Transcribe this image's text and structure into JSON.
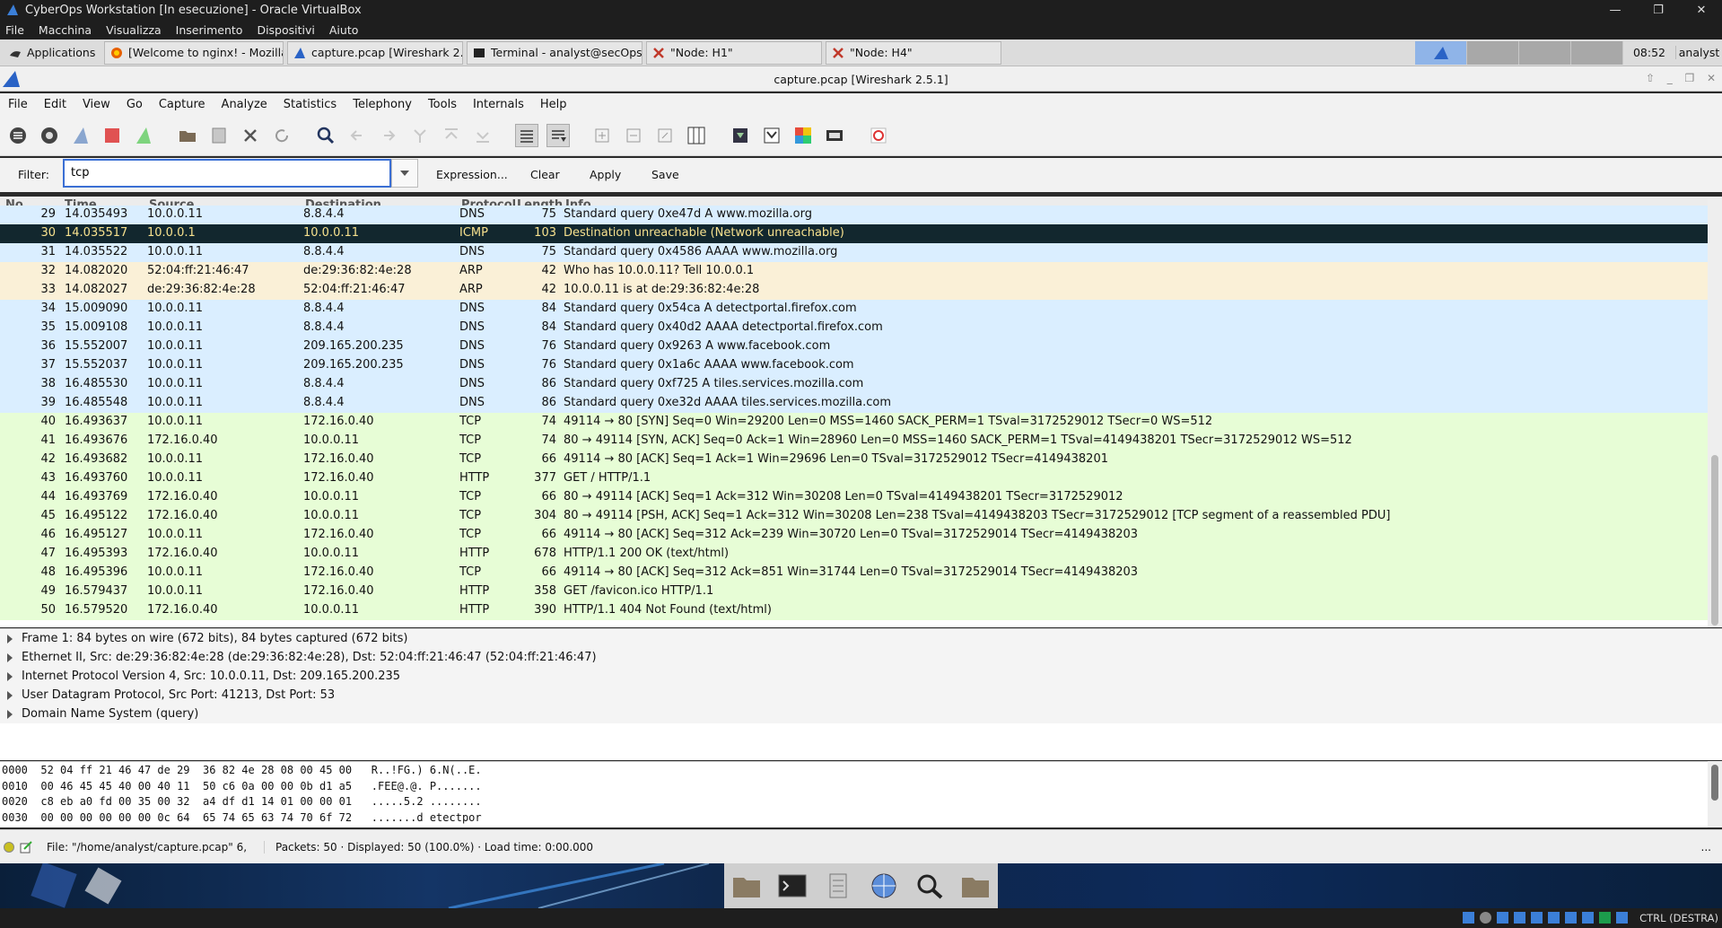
{
  "vbox": {
    "title": "CyberOps Workstation [In esecuzione] - Oracle VirtualBox",
    "menu": [
      "File",
      "Macchina",
      "Visualizza",
      "Inserimento",
      "Dispositivi",
      "Aiuto"
    ],
    "host_key": "CTRL (DESTRA)"
  },
  "taskbar": {
    "applications": "Applications",
    "tasks": [
      "[Welcome to nginx! - Mozilla...",
      "capture.pcap [Wireshark 2....",
      "Terminal - analyst@secOps:~",
      "\"Node: H1\"",
      "\"Node: H4\""
    ],
    "clock": "08:52",
    "user": "analyst"
  },
  "wireshark": {
    "window_title": "capture.pcap [Wireshark 2.5.1]",
    "menu": [
      "File",
      "Edit",
      "View",
      "Go",
      "Capture",
      "Analyze",
      "Statistics",
      "Telephony",
      "Tools",
      "Internals",
      "Help"
    ],
    "filter": {
      "label": "Filter:",
      "value": "tcp",
      "expression": "Expression...",
      "clear": "Clear",
      "apply": "Apply",
      "save": "Save"
    },
    "columns": [
      "No.",
      "Time",
      "Source",
      "Destination",
      "Protocol",
      "Length",
      "Info"
    ],
    "packets": [
      {
        "no": "29",
        "time": "14.035493",
        "src": "10.0.0.11",
        "dst": "8.8.4.4",
        "proto": "DNS",
        "len": "75",
        "info": "Standard query 0xe47d A www.mozilla.org",
        "kind": "udp"
      },
      {
        "no": "30",
        "time": "14.035517",
        "src": "10.0.0.1",
        "dst": "10.0.0.11",
        "proto": "ICMP",
        "len": "103",
        "info": "Destination unreachable (Network unreachable)",
        "kind": "err"
      },
      {
        "no": "31",
        "time": "14.035522",
        "src": "10.0.0.11",
        "dst": "8.8.4.4",
        "proto": "DNS",
        "len": "75",
        "info": "Standard query 0x4586 AAAA www.mozilla.org",
        "kind": "udp"
      },
      {
        "no": "32",
        "time": "14.082020",
        "src": "52:04:ff:21:46:47",
        "dst": "de:29:36:82:4e:28",
        "proto": "ARP",
        "len": "42",
        "info": "Who has 10.0.0.11? Tell 10.0.0.1",
        "kind": "arp"
      },
      {
        "no": "33",
        "time": "14.082027",
        "src": "de:29:36:82:4e:28",
        "dst": "52:04:ff:21:46:47",
        "proto": "ARP",
        "len": "42",
        "info": "10.0.0.11 is at de:29:36:82:4e:28",
        "kind": "arp"
      },
      {
        "no": "34",
        "time": "15.009090",
        "src": "10.0.0.11",
        "dst": "8.8.4.4",
        "proto": "DNS",
        "len": "84",
        "info": "Standard query 0x54ca A detectportal.firefox.com",
        "kind": "udp"
      },
      {
        "no": "35",
        "time": "15.009108",
        "src": "10.0.0.11",
        "dst": "8.8.4.4",
        "proto": "DNS",
        "len": "84",
        "info": "Standard query 0x40d2 AAAA detectportal.firefox.com",
        "kind": "udp"
      },
      {
        "no": "36",
        "time": "15.552007",
        "src": "10.0.0.11",
        "dst": "209.165.200.235",
        "proto": "DNS",
        "len": "76",
        "info": "Standard query 0x9263 A www.facebook.com",
        "kind": "udp"
      },
      {
        "no": "37",
        "time": "15.552037",
        "src": "10.0.0.11",
        "dst": "209.165.200.235",
        "proto": "DNS",
        "len": "76",
        "info": "Standard query 0x1a6c AAAA www.facebook.com",
        "kind": "udp"
      },
      {
        "no": "38",
        "time": "16.485530",
        "src": "10.0.0.11",
        "dst": "8.8.4.4",
        "proto": "DNS",
        "len": "86",
        "info": "Standard query 0xf725 A tiles.services.mozilla.com",
        "kind": "udp"
      },
      {
        "no": "39",
        "time": "16.485548",
        "src": "10.0.0.11",
        "dst": "8.8.4.4",
        "proto": "DNS",
        "len": "86",
        "info": "Standard query 0xe32d AAAA tiles.services.mozilla.com",
        "kind": "udp"
      },
      {
        "no": "40",
        "time": "16.493637",
        "src": "10.0.0.11",
        "dst": "172.16.0.40",
        "proto": "TCP",
        "len": "74",
        "info": "49114 → 80 [SYN] Seq=0 Win=29200 Len=0 MSS=1460 SACK_PERM=1 TSval=3172529012 TSecr=0 WS=512",
        "kind": "tcp"
      },
      {
        "no": "41",
        "time": "16.493676",
        "src": "172.16.0.40",
        "dst": "10.0.0.11",
        "proto": "TCP",
        "len": "74",
        "info": "80 → 49114 [SYN, ACK] Seq=0 Ack=1 Win=28960 Len=0 MSS=1460 SACK_PERM=1 TSval=4149438201 TSecr=3172529012 WS=512",
        "kind": "tcp"
      },
      {
        "no": "42",
        "time": "16.493682",
        "src": "10.0.0.11",
        "dst": "172.16.0.40",
        "proto": "TCP",
        "len": "66",
        "info": "49114 → 80 [ACK] Seq=1 Ack=1 Win=29696 Len=0 TSval=3172529012 TSecr=4149438201",
        "kind": "tcp"
      },
      {
        "no": "43",
        "time": "16.493760",
        "src": "10.0.0.11",
        "dst": "172.16.0.40",
        "proto": "HTTP",
        "len": "377",
        "info": "GET / HTTP/1.1",
        "kind": "tcp"
      },
      {
        "no": "44",
        "time": "16.493769",
        "src": "172.16.0.40",
        "dst": "10.0.0.11",
        "proto": "TCP",
        "len": "66",
        "info": "80 → 49114 [ACK] Seq=1 Ack=312 Win=30208 Len=0 TSval=4149438201 TSecr=3172529012",
        "kind": "tcp"
      },
      {
        "no": "45",
        "time": "16.495122",
        "src": "172.16.0.40",
        "dst": "10.0.0.11",
        "proto": "TCP",
        "len": "304",
        "info": "80 → 49114 [PSH, ACK] Seq=1 Ack=312 Win=30208 Len=238 TSval=4149438203 TSecr=3172529012 [TCP segment of a reassembled PDU]",
        "kind": "tcp"
      },
      {
        "no": "46",
        "time": "16.495127",
        "src": "10.0.0.11",
        "dst": "172.16.0.40",
        "proto": "TCP",
        "len": "66",
        "info": "49114 → 80 [ACK] Seq=312 Ack=239 Win=30720 Len=0 TSval=3172529014 TSecr=4149438203",
        "kind": "tcp"
      },
      {
        "no": "47",
        "time": "16.495393",
        "src": "172.16.0.40",
        "dst": "10.0.0.11",
        "proto": "HTTP",
        "len": "678",
        "info": "HTTP/1.1 200 OK  (text/html)",
        "kind": "tcp"
      },
      {
        "no": "48",
        "time": "16.495396",
        "src": "10.0.0.11",
        "dst": "172.16.0.40",
        "proto": "TCP",
        "len": "66",
        "info": "49114 → 80 [ACK] Seq=312 Ack=851 Win=31744 Len=0 TSval=3172529014 TSecr=4149438203",
        "kind": "tcp"
      },
      {
        "no": "49",
        "time": "16.579437",
        "src": "10.0.0.11",
        "dst": "172.16.0.40",
        "proto": "HTTP",
        "len": "358",
        "info": "GET /favicon.ico HTTP/1.1",
        "kind": "tcp"
      },
      {
        "no": "50",
        "time": "16.579520",
        "src": "172.16.0.40",
        "dst": "10.0.0.11",
        "proto": "HTTP",
        "len": "390",
        "info": "HTTP/1.1 404 Not Found  (text/html)",
        "kind": "tcp"
      }
    ],
    "details": [
      "Frame 1: 84 bytes on wire (672 bits), 84 bytes captured (672 bits)",
      "Ethernet II, Src: de:29:36:82:4e:28 (de:29:36:82:4e:28), Dst: 52:04:ff:21:46:47 (52:04:ff:21:46:47)",
      "Internet Protocol Version 4, Src: 10.0.0.11, Dst: 209.165.200.235",
      "User Datagram Protocol, Src Port: 41213, Dst Port: 53",
      "Domain Name System (query)"
    ],
    "hex": [
      "0000  52 04 ff 21 46 47 de 29  36 82 4e 28 08 00 45 00   R..!FG.) 6.N(..E.",
      "0010  00 46 45 45 40 00 40 11  50 c6 0a 00 00 0b d1 a5   .FEE@.@. P.......",
      "0020  c8 eb a0 fd 00 35 00 32  a4 df d1 14 01 00 00 01   .....5.2 ........",
      "0030  00 00 00 00 00 00 0c 64  65 74 65 63 74 70 6f 72   .......d etectpor"
    ],
    "status": {
      "file": "File: \"/home/analyst/capture.pcap\" 6,...",
      "packets": "Packets: 50 · Displayed: 50 (100.0%) · Load time: 0:00.000",
      "more": "..."
    }
  },
  "colors": {
    "udp": "#daeeff",
    "tcp": "#e7fdd6",
    "arp": "#faf0d7",
    "err_bg": "#12272e",
    "err_fg": "#f7e18e"
  }
}
